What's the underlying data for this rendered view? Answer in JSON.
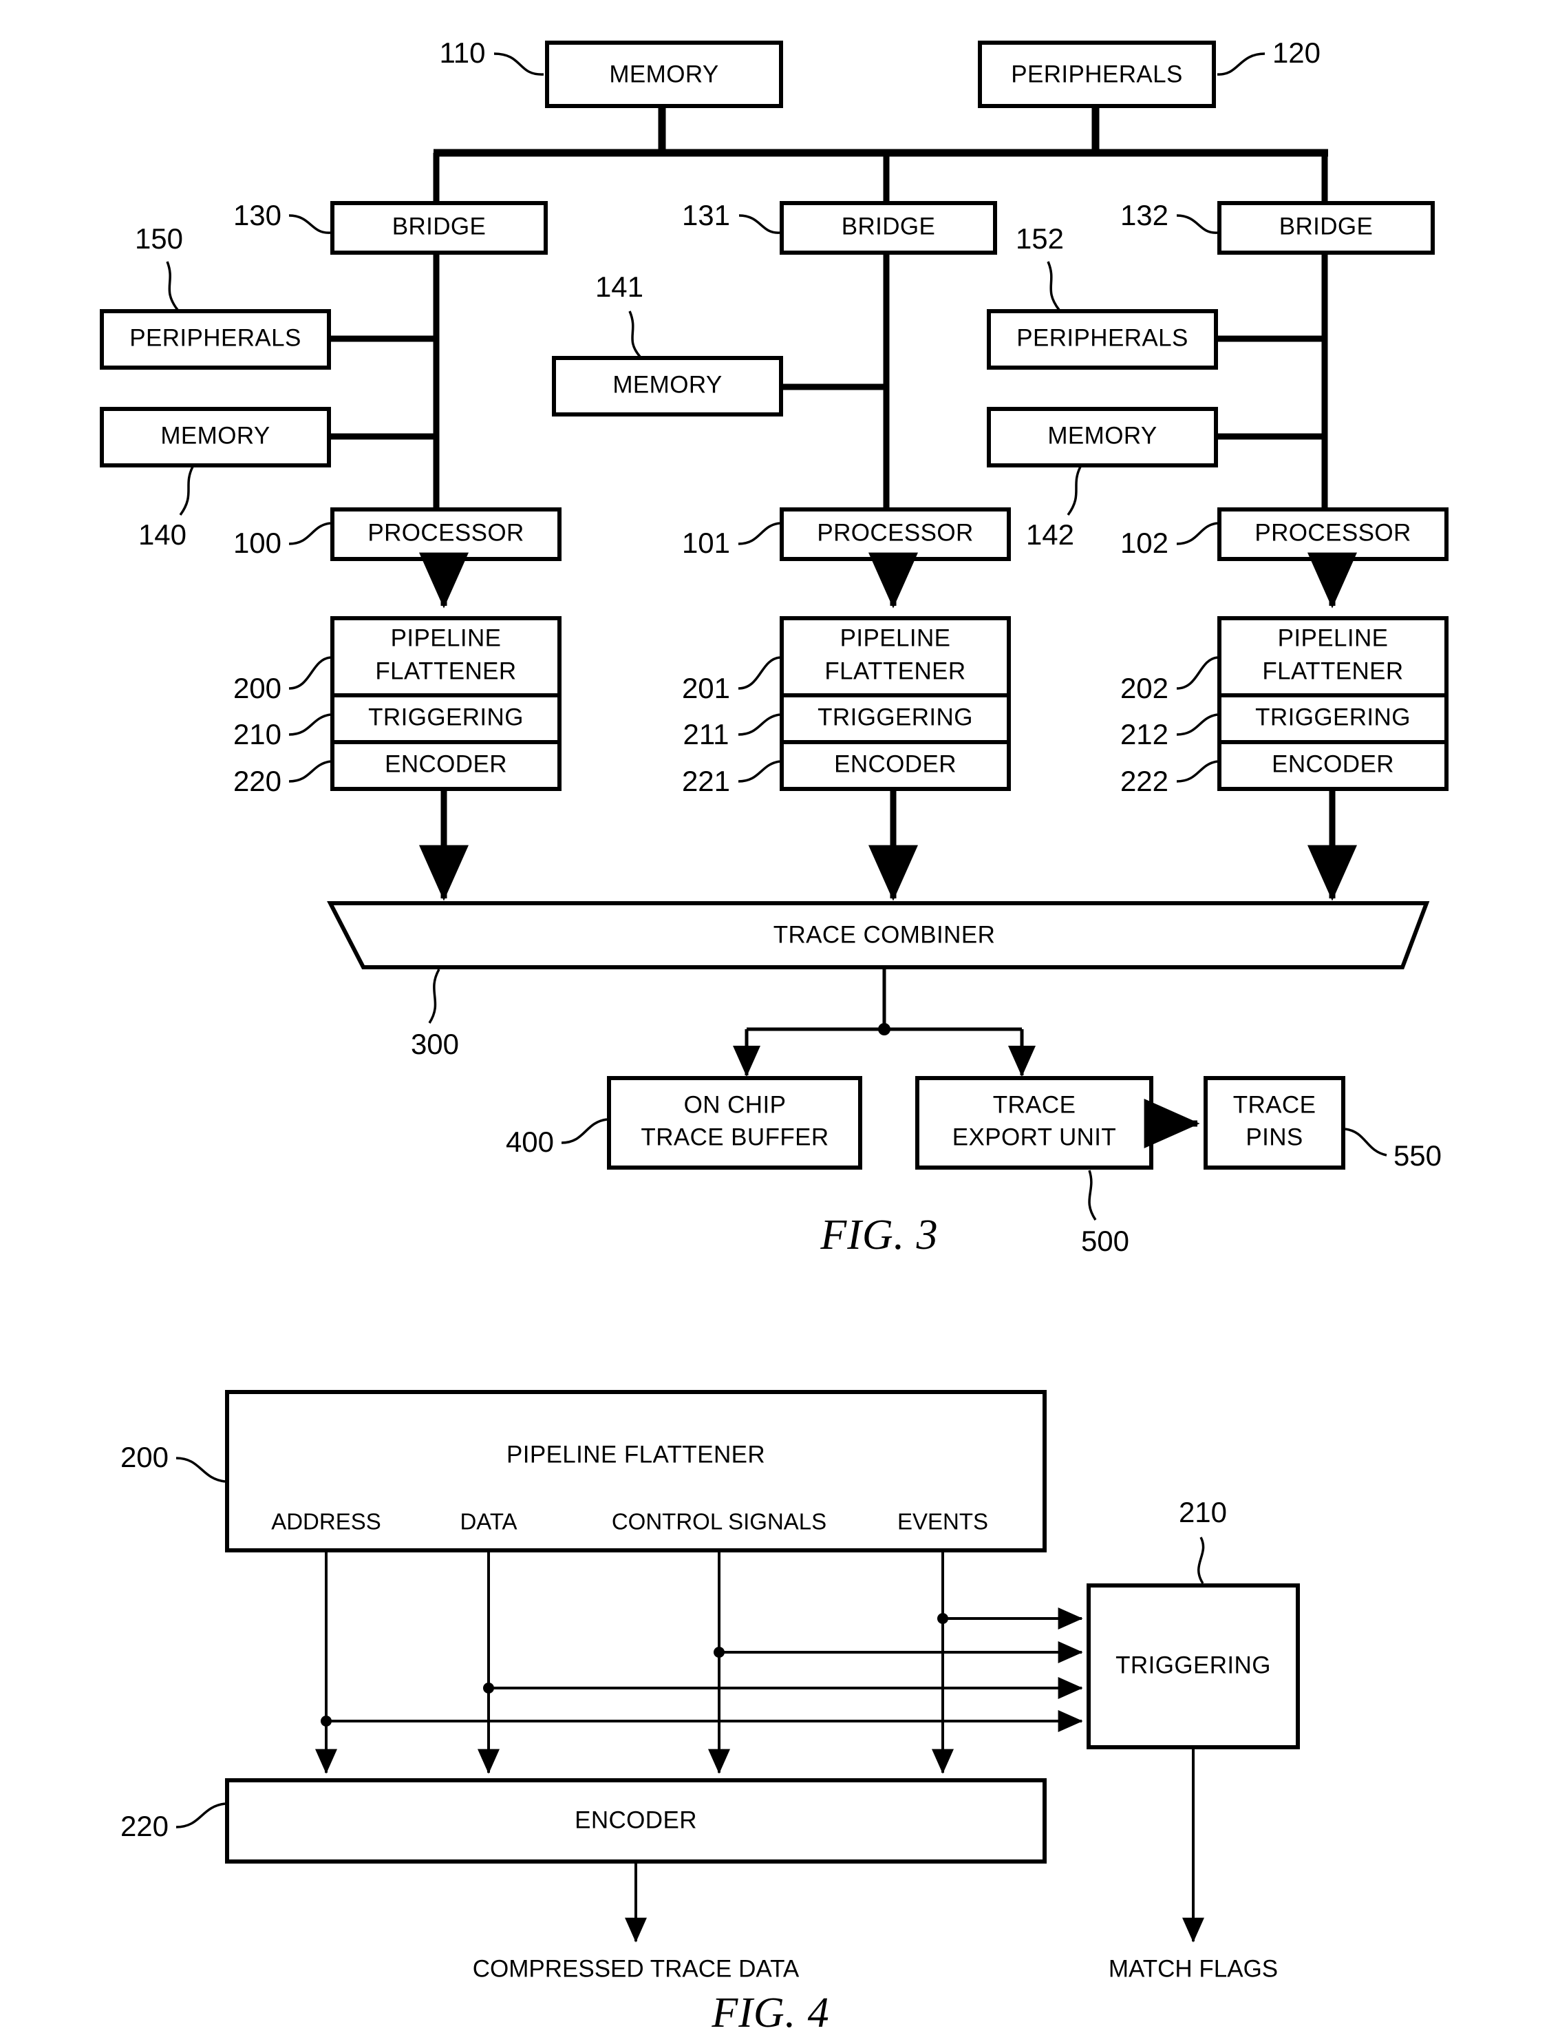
{
  "figures": [
    {
      "id": "fig3",
      "caption": "FIG. 3",
      "blocks": {
        "top_memory": "MEMORY",
        "top_peripherals": "PERIPHERALS",
        "bridge_left": "BRIDGE",
        "bridge_mid": "BRIDGE",
        "bridge_right": "BRIDGE",
        "left_peripherals": "PERIPHERALS",
        "left_memory": "MEMORY",
        "mid_memory": "MEMORY",
        "right_peripherals": "PERIPHERALS",
        "right_memory": "MEMORY",
        "processor_left": "PROCESSOR",
        "processor_mid": "PROCESSOR",
        "processor_right": "PROCESSOR",
        "flattener_left": [
          "PIPELINE",
          "FLATTENER"
        ],
        "flattener_mid": [
          "PIPELINE",
          "FLATTENER"
        ],
        "flattener_right": [
          "PIPELINE",
          "FLATTENER"
        ],
        "triggering_left": "TRIGGERING",
        "triggering_mid": "TRIGGERING",
        "triggering_right": "TRIGGERING",
        "encoder_left": "ENCODER",
        "encoder_mid": "ENCODER",
        "encoder_right": "ENCODER",
        "trace_combiner": "TRACE COMBINER",
        "on_chip_trace_buffer": [
          "ON CHIP",
          "TRACE BUFFER"
        ],
        "trace_export_unit": [
          "TRACE",
          "EXPORT UNIT"
        ],
        "trace_pins": [
          "TRACE",
          "PINS"
        ]
      },
      "refs": {
        "top_memory": "110",
        "top_peripherals": "120",
        "bridge_left": "130",
        "bridge_mid": "131",
        "bridge_right": "132",
        "left_peripherals": "150",
        "left_memory": "140",
        "mid_memory": "141",
        "right_peripherals": "152",
        "right_memory": "142",
        "processor_left": "100",
        "processor_mid": "101",
        "processor_right": "102",
        "flattener_left": "200",
        "flattener_mid": "201",
        "flattener_right": "202",
        "triggering_left": "210",
        "triggering_mid": "211",
        "triggering_right": "212",
        "encoder_left": "220",
        "encoder_mid": "221",
        "encoder_right": "222",
        "trace_combiner": "300",
        "on_chip_trace_buffer": "400",
        "trace_export_unit": "500",
        "trace_pins": "550"
      }
    },
    {
      "id": "fig4",
      "caption": "FIG. 4",
      "blocks": {
        "pipeline_flattener": "PIPELINE FLATTENER",
        "triggering": "TRIGGERING",
        "encoder": "ENCODER"
      },
      "ports": [
        "ADDRESS",
        "DATA",
        "CONTROL SIGNALS",
        "EVENTS"
      ],
      "outputs": {
        "compressed": "COMPRESSED TRACE DATA",
        "match_flags": "MATCH FLAGS"
      },
      "refs": {
        "pipeline_flattener": "200",
        "triggering": "210",
        "encoder": "220"
      }
    }
  ]
}
